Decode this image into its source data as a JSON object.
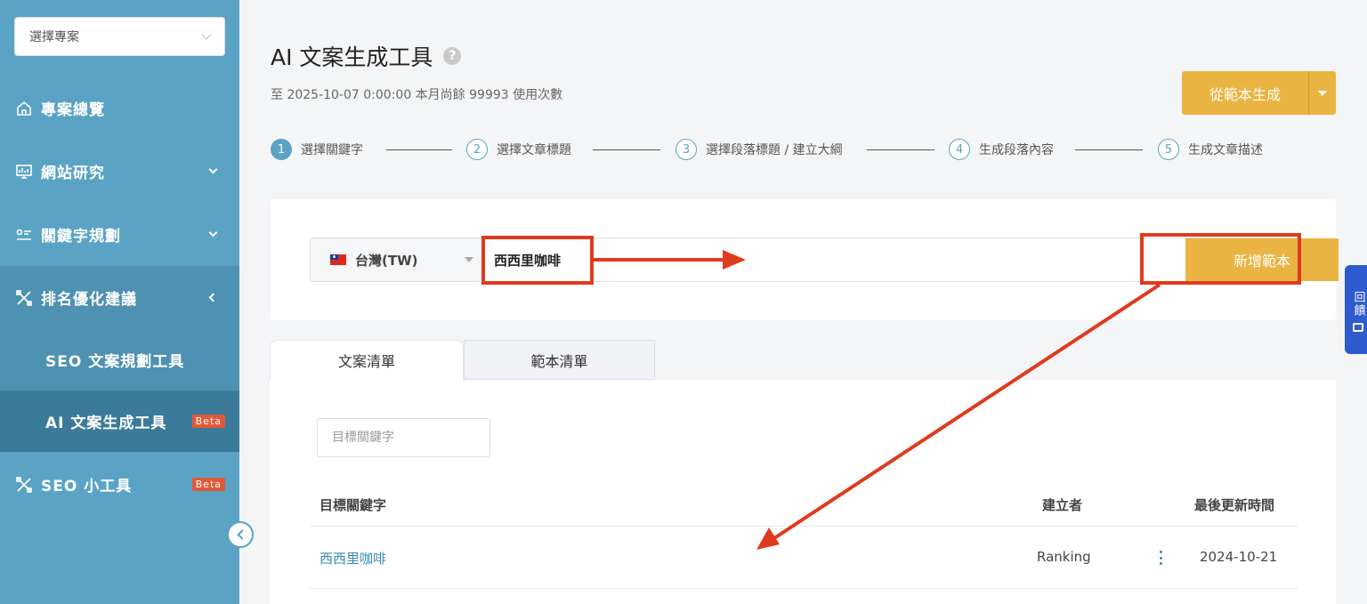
{
  "sidebar": {
    "project_select": "選擇專案",
    "items": [
      {
        "label": "專案總覽"
      },
      {
        "label": "網站研究"
      },
      {
        "label": "關鍵字規劃"
      },
      {
        "label": "排名優化建議"
      }
    ],
    "sub_items": [
      {
        "label": "SEO 文案規劃工具"
      },
      {
        "label": "AI 文案生成工具",
        "badge": "Beta"
      }
    ],
    "tools": {
      "label": "SEO 小工具",
      "badge": "Beta"
    }
  },
  "header": {
    "title": "AI 文案生成工具",
    "help": "?",
    "subtitle": "至 2025-10-07 0:00:00 本月尚餘 99993 使用次數",
    "generate_button": "從範本生成"
  },
  "steps": [
    {
      "num": "1",
      "label": "選擇關鍵字"
    },
    {
      "num": "2",
      "label": "選擇文章標題"
    },
    {
      "num": "3",
      "label": "選擇段落標題 / 建立大綱"
    },
    {
      "num": "4",
      "label": "生成段落內容"
    },
    {
      "num": "5",
      "label": "生成文章描述"
    }
  ],
  "search": {
    "region": "台灣(TW)",
    "keyword": "西西里咖啡",
    "add_button": "新增範本"
  },
  "tabs": [
    {
      "label": "文案清單"
    },
    {
      "label": "範本清單"
    }
  ],
  "table": {
    "filter_placeholder": "目標關鍵字",
    "headers": [
      "目標關鍵字",
      "建立者",
      "最後更新時間"
    ],
    "rows": [
      {
        "keyword": "西西里咖啡",
        "creator": "Ranking",
        "updated": "2024-10-21"
      }
    ]
  },
  "side_tab": {
    "label": "回饋"
  },
  "colors": {
    "sidebar": "#5aa3c5",
    "accent": "#e9b441",
    "annotation": "#e03a1e"
  }
}
